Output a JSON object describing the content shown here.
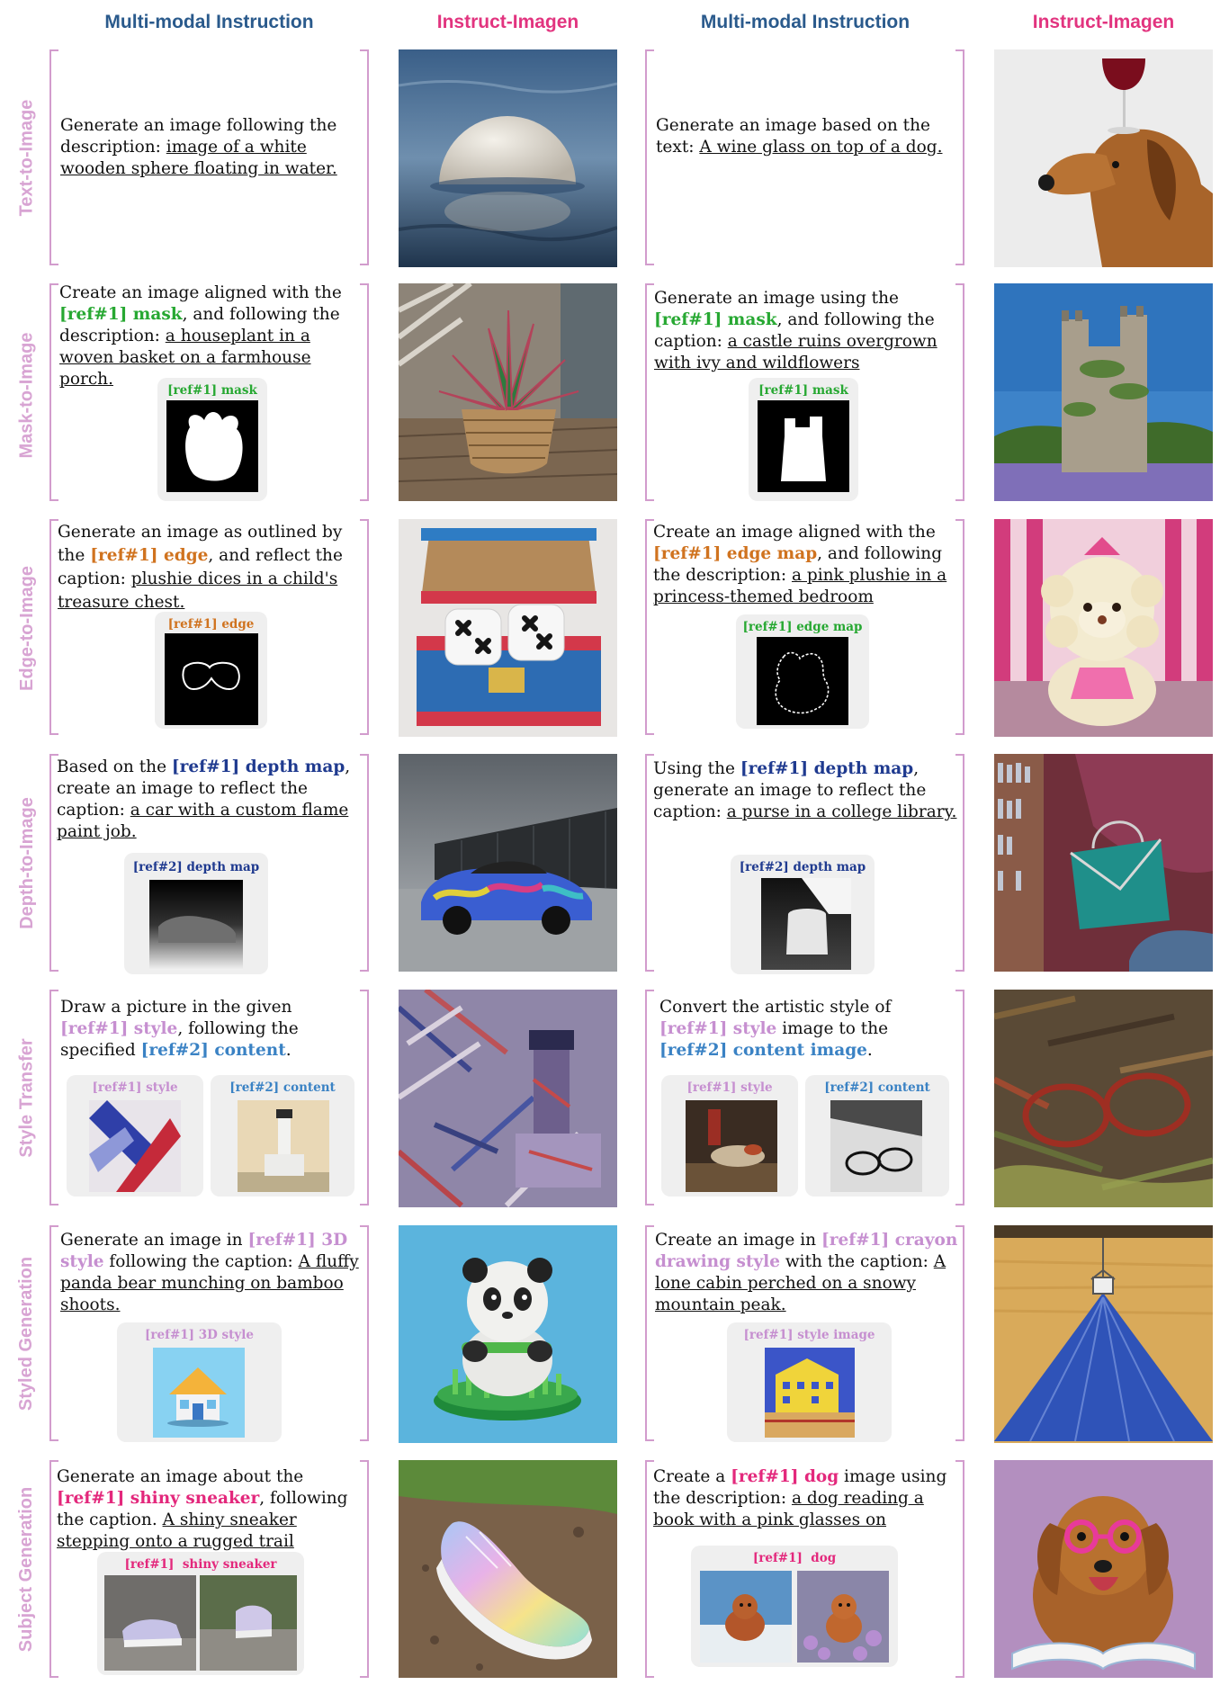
{
  "headers": {
    "mm1": "Multi-modal Instruction",
    "ii1": "Instruct-Imagen",
    "mm2": "Multi-modal Instruction",
    "ii2": "Instruct-Imagen"
  },
  "colors": {
    "mm_header": "#2a5a8c",
    "ii_header": "#e2347f",
    "row_label": "#d8a4d3",
    "bracket": "#d29ccd"
  },
  "rows": {
    "t2i": {
      "label": "Text-to-Image",
      "left": {
        "pre": "Generate an image following the description: ",
        "caption": "image of a white wooden sphere floating in water."
      },
      "right": {
        "pre": "Generate an image based on the text: ",
        "caption": "A wine glass on top of a dog."
      }
    },
    "m2i": {
      "label": "Mask-to-Image",
      "left": {
        "pre": "Create an image aligned with the ",
        "ref": "[ref#1] mask",
        "mid": ", and following the description: ",
        "caption": "a houseplant in a woven basket on a farmhouse porch.",
        "ref_caption": "[ref#1] mask"
      },
      "right": {
        "pre": "Generate an image using the ",
        "ref": "[ref#1] mask",
        "mid": ", and following the caption: ",
        "caption": "a castle ruins overgrown with ivy and wildflowers",
        "ref_caption": "[ref#1] mask"
      }
    },
    "e2i": {
      "label": "Edge-to-Image",
      "left": {
        "pre": "Generate an image as outlined by the ",
        "ref": "[ref#1] edge",
        "mid": ", and reflect the caption: ",
        "caption": "plushie dices in a child's treasure chest.",
        "ref_caption": "[ref#1] edge"
      },
      "right": {
        "pre": "Create an image aligned with the ",
        "ref": "[ref#1] edge map",
        "mid": ", and following the description: ",
        "caption": "a pink plushie in a princess-themed bedroom",
        "ref_caption": "[ref#1] edge map"
      }
    },
    "d2i": {
      "label": "Depth-to-Image",
      "left": {
        "pre": "Based on the ",
        "ref": "[ref#1] depth map",
        "mid": ", create an image to reflect the caption: ",
        "caption": "a car with a custom flame paint job.",
        "ref_caption": "[ref#2] depth map"
      },
      "right": {
        "pre": "Using the ",
        "ref": "[ref#1] depth map",
        "mid": ", generate an image to reflect the caption: ",
        "caption": "a purse in a college library.",
        "ref_caption": "[ref#2] depth map"
      }
    },
    "st": {
      "label": "Style Transfer",
      "left": {
        "pre": "Draw a picture in the given ",
        "ref1": "[ref#1] style",
        "mid": ", following the specified ",
        "ref2": "[ref#2] content",
        "post": ".",
        "cap1": "[ref#1] style",
        "cap2": "[ref#2] content"
      },
      "right": {
        "pre": "Convert the artistic style of ",
        "ref1": "[ref#1] style",
        "mid": " image to the ",
        "ref2": "[ref#2] content image",
        "post": ".",
        "cap1": "[ref#1] style",
        "cap2": "[ref#2] content"
      }
    },
    "sg": {
      "label": "Styled Generation",
      "left": {
        "pre": "Generate an image in ",
        "ref": "[ref#1] 3D style",
        "mid": " following the caption: ",
        "caption": "A fluffy panda bear munching on bamboo shoots.",
        "ref_caption": "[ref#1] 3D style"
      },
      "right": {
        "pre": "Create an image in ",
        "ref": "[ref#1] crayon drawing style",
        "mid": " with the caption: ",
        "caption": "A lone cabin perched on a snowy mountain peak.",
        "ref_caption": "[ref#1] style image"
      }
    },
    "sub": {
      "label": "Subject Generation",
      "left": {
        "pre": "Generate an image about the ",
        "ref": "[ref#1] shiny sneaker",
        "mid": ", following the caption. ",
        "caption": "A shiny sneaker stepping onto a rugged trail",
        "ref_caption": "[ref#1]  shiny sneaker"
      },
      "right": {
        "pre": "Create a ",
        "ref": "[ref#1] dog",
        "mid": " image using the description: ",
        "caption": "a dog reading a book with a pink glasses on",
        "ref_caption": "[ref#1]  dog"
      }
    }
  }
}
